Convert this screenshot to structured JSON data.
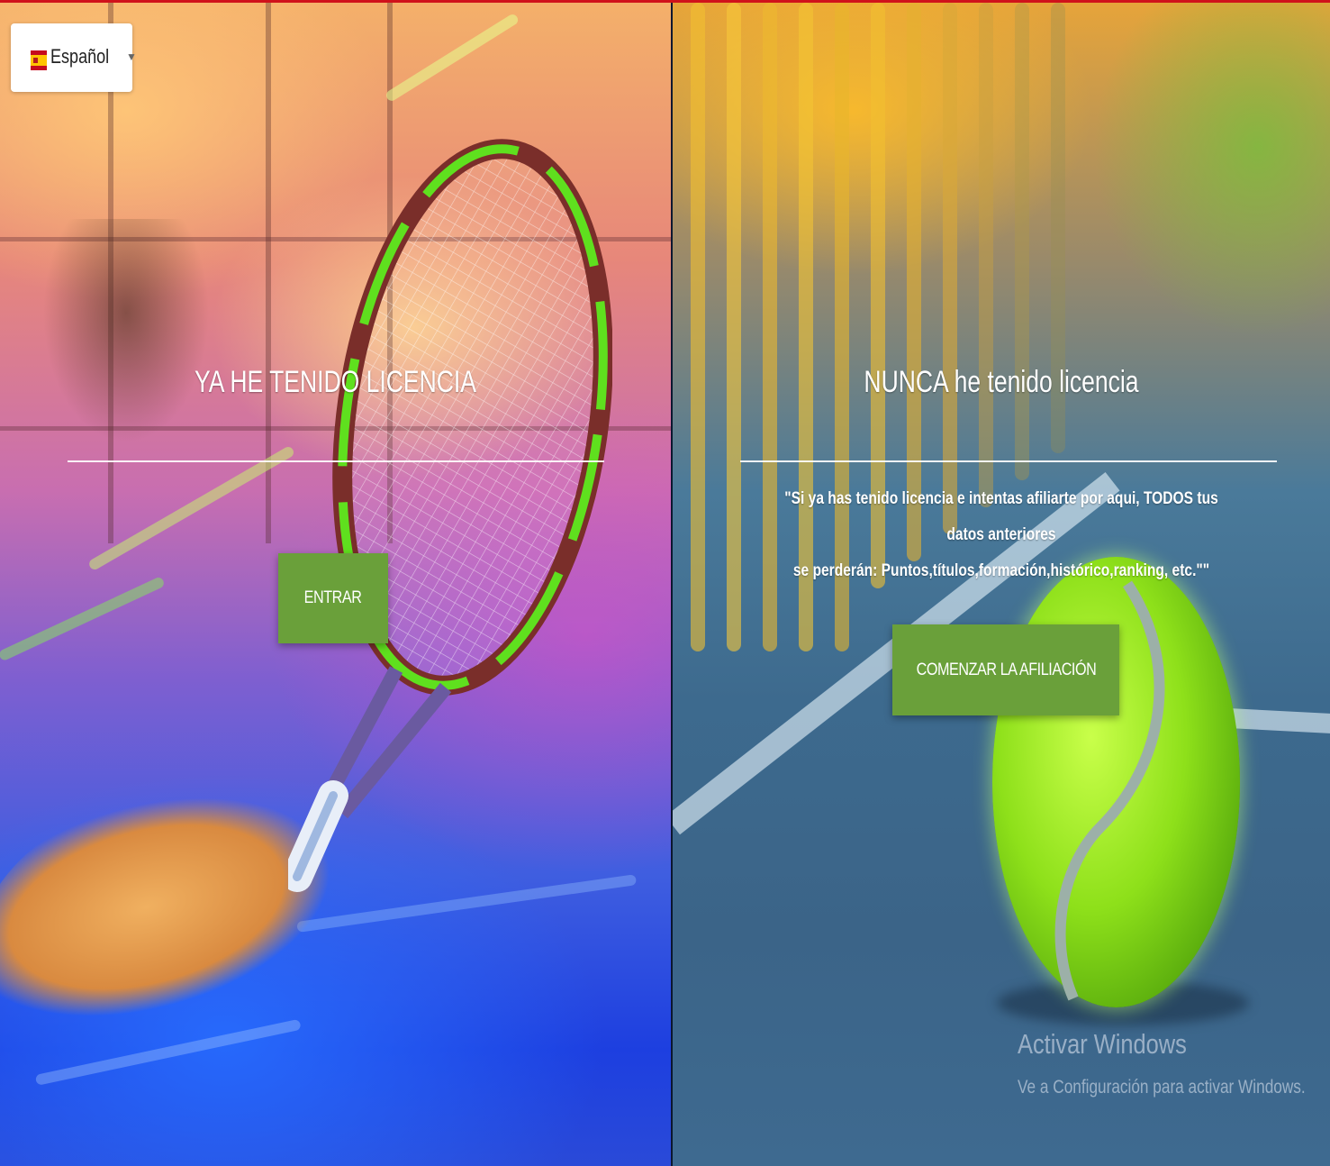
{
  "language_selector": {
    "label": "Español",
    "flag_icon": "spain-flag-icon",
    "arrow_icon": "dropdown-arrow-icon"
  },
  "left_panel": {
    "title": "YA HE TENIDO LICENCIA",
    "button_label": "ENTRAR"
  },
  "right_panel": {
    "title": "NUNCA he tenido licencia",
    "warning_line1": "\"Si ya has tenido licencia e intentas afiliarte por aqui, TODOS tus datos anteriores",
    "warning_line2": "se perderán: Puntos,títulos,formación,histórico,ranking, etc.\"\"",
    "button_label": "COMENZAR LA AFILIACIÓN"
  },
  "watermark": {
    "title": "Activar Windows",
    "subtitle": "Ve a Configuración para activar Windows."
  },
  "colors": {
    "button": "#6aa03a",
    "top_bar": "#d0121b"
  }
}
